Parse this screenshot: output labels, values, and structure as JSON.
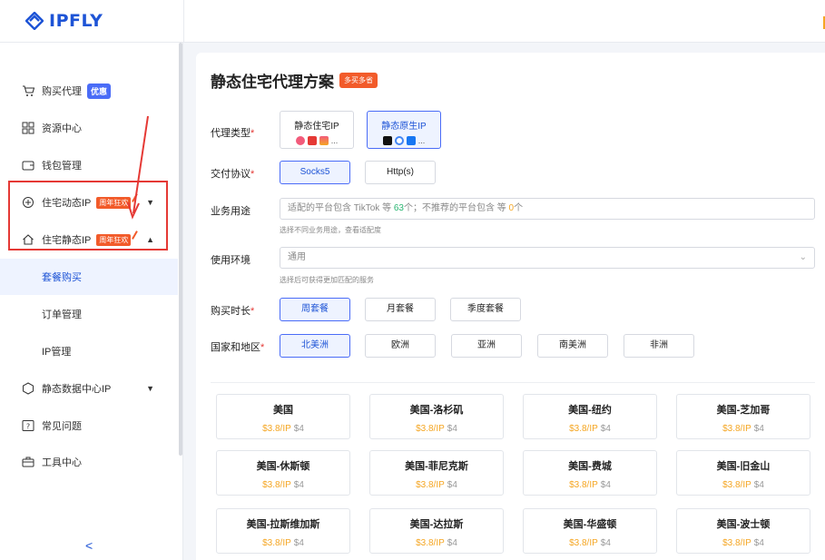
{
  "brand": {
    "name": "IPFLY"
  },
  "sidebar": {
    "items": [
      {
        "label": "购买代理",
        "badge": "优惠",
        "icon": "cart-icon"
      },
      {
        "label": "资源中心",
        "icon": "grid-icon"
      },
      {
        "label": "钱包管理",
        "icon": "wallet-icon"
      },
      {
        "label": "住宅动态IP",
        "badge": "周年狂欢",
        "icon": "dynamic-ip-icon"
      },
      {
        "label": "住宅静态IP",
        "badge": "周年狂欢",
        "icon": "home-icon"
      },
      {
        "label": "静态数据中心IP",
        "icon": "datacenter-icon"
      },
      {
        "label": "常见问题",
        "icon": "faq-icon"
      },
      {
        "label": "工具中心",
        "icon": "toolbox-icon"
      }
    ],
    "sub_items": [
      "套餐购买",
      "订单管理",
      "IP管理"
    ],
    "collapse": "<"
  },
  "main": {
    "title": "静态住宅代理方案",
    "title_badge": "多买多省",
    "proxy_type": {
      "label": "代理类型",
      "options": [
        {
          "label": "静态住宅IP",
          "more": "..."
        },
        {
          "label": "静态原生IP",
          "more": "..."
        }
      ]
    },
    "protocol": {
      "label": "交付协议",
      "options": [
        "Socks5",
        "Http(s)"
      ]
    },
    "usage": {
      "label": "业务用途",
      "placeholder_a": "适配的平台包含 TikTok 等 ",
      "count_ok": "63",
      "placeholder_b": "个；不推荐的平台包含 等 ",
      "count_bad": "0",
      "placeholder_c": "个",
      "hint": "选择不同业务用途，查看适配度"
    },
    "env": {
      "label": "使用环境",
      "value": "通用",
      "hint": "选择后可获得更加匹配的服务"
    },
    "duration": {
      "label": "购买时长",
      "options": [
        "周套餐",
        "月套餐",
        "季度套餐"
      ]
    },
    "region": {
      "label": "国家和地区",
      "options": [
        "北美洲",
        "欧洲",
        "亚洲",
        "南美洲",
        "非洲"
      ]
    },
    "cities": [
      {
        "name": "美国",
        "price": "$3.8/IP",
        "old": "$4"
      },
      {
        "name": "美国-洛杉矶",
        "price": "$3.8/IP",
        "old": "$4"
      },
      {
        "name": "美国-纽约",
        "price": "$3.8/IP",
        "old": "$4"
      },
      {
        "name": "美国-芝加哥",
        "price": "$3.8/IP",
        "old": "$4"
      },
      {
        "name": "美国-休斯顿",
        "price": "$3.8/IP",
        "old": "$4"
      },
      {
        "name": "美国-菲尼克斯",
        "price": "$3.8/IP",
        "old": "$4"
      },
      {
        "name": "美国-费城",
        "price": "$3.8/IP",
        "old": "$4"
      },
      {
        "name": "美国-旧金山",
        "price": "$3.8/IP",
        "old": "$4"
      },
      {
        "name": "美国-拉斯维加斯",
        "price": "$3.8/IP",
        "old": "$4"
      },
      {
        "name": "美国-达拉斯",
        "price": "$3.8/IP",
        "old": "$4"
      },
      {
        "name": "美国-华盛顿",
        "price": "$3.8/IP",
        "old": "$4"
      },
      {
        "name": "美国-波士顿",
        "price": "$3.8/IP",
        "old": "$4"
      }
    ]
  },
  "colors": {
    "accent": "#1e54d6",
    "selected_bg": "#eef3ff",
    "price": "#f5a623",
    "hot": "#f25b2a",
    "annotation": "#e53935"
  }
}
